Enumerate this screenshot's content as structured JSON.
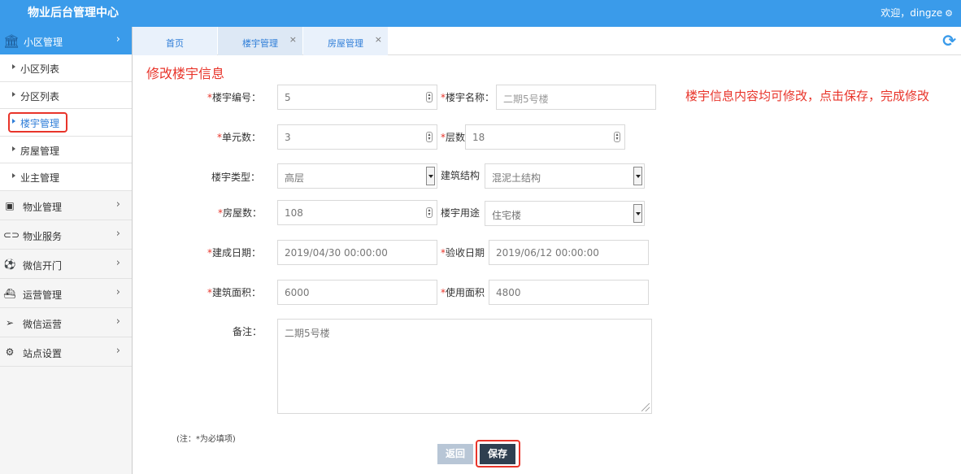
{
  "header": {
    "app_title": "物业后台管理中心",
    "welcome": "欢迎，dingze"
  },
  "sidebar": {
    "section": {
      "label": "小区管理",
      "icon": "bank-icon"
    },
    "sub_items": [
      {
        "label": "小区列表"
      },
      {
        "label": "分区列表"
      },
      {
        "label": "楼宇管理",
        "active": true
      },
      {
        "label": "房屋管理"
      },
      {
        "label": "业主管理"
      }
    ],
    "groups": [
      {
        "label": "物业管理",
        "icon": "os-icon"
      },
      {
        "label": "物业服务",
        "icon": "toggle-icon"
      },
      {
        "label": "微信开门",
        "icon": "ball-icon"
      },
      {
        "label": "运营管理",
        "icon": "ship-icon"
      },
      {
        "label": "微信运营",
        "icon": "paper-plane-icon"
      },
      {
        "label": "站点设置",
        "icon": "gears-icon"
      }
    ]
  },
  "tabs": [
    {
      "label": "首页"
    },
    {
      "label": "楼宇管理",
      "active": true,
      "closable": true
    },
    {
      "label": "房屋管理",
      "closable": true
    }
  ],
  "form": {
    "title": "修改楼宇信息",
    "annotation": "楼宇信息内容均可修改，点击保存，完成修改",
    "fields": {
      "building_no": {
        "label": "楼宇编号：",
        "value": "5"
      },
      "building_name": {
        "label": "楼宇名称：",
        "placeholder": "二期5号楼"
      },
      "unit_count": {
        "label": "单元数：",
        "value": "3"
      },
      "floors": {
        "label": "层数",
        "value": "18"
      },
      "building_type": {
        "label": "楼宇类型：",
        "value": "高层"
      },
      "structure": {
        "label": "建筑结构",
        "value": "混泥土结构"
      },
      "house_count": {
        "label": "房屋数：",
        "value": "108"
      },
      "usage": {
        "label": "楼宇用途",
        "value": "住宅楼"
      },
      "built_date": {
        "label": "建成日期：",
        "value": "2019/04/30 00:00:00"
      },
      "accept_date": {
        "label": "验收日期",
        "value": "2019/06/12 00:00:00"
      },
      "build_area": {
        "label": "建筑面积：",
        "value": "6000"
      },
      "use_area": {
        "label": "使用面积",
        "value": "4800"
      },
      "remark": {
        "label": "备注：",
        "value": "二期5号楼"
      }
    },
    "required_marker": "*",
    "footnote": "(注：*为必填项)",
    "buttons": {
      "back": "返回",
      "save": "保存"
    }
  }
}
